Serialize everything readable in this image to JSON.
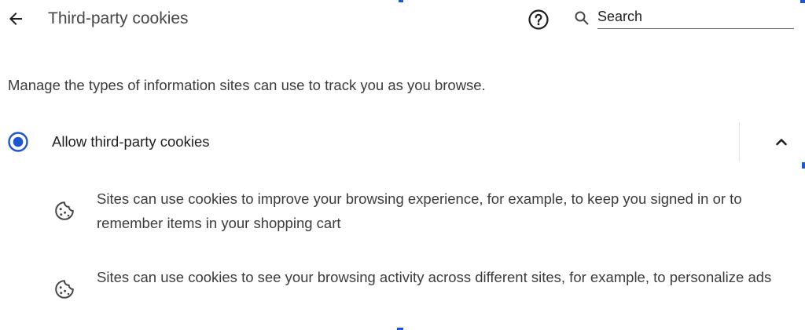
{
  "header": {
    "title": "Third-party cookies",
    "back_icon": "arrow-back-icon",
    "help_icon": "help-circle-icon"
  },
  "search": {
    "placeholder": "Search",
    "icon": "search-icon"
  },
  "main": {
    "description": "Manage the types of information sites can use to track you as you browse.",
    "option": {
      "label": "Allow third-party cookies",
      "selected": true,
      "expanded": true,
      "expand_icon": "chevron-up-icon"
    },
    "details": [
      {
        "icon": "cookie-icon",
        "text": "Sites can use cookies to improve your browsing experience, for example, to keep you signed in or to remember items in your shopping cart"
      },
      {
        "icon": "cookie-icon",
        "text": "Sites can use cookies to see your browsing activity across different sites, for example, to personalize ads"
      }
    ]
  },
  "colors": {
    "accent": "#1a56d6",
    "text_primary": "#1f1f1f",
    "text_secondary": "#3c3c3c",
    "divider": "#e3e3e3"
  }
}
